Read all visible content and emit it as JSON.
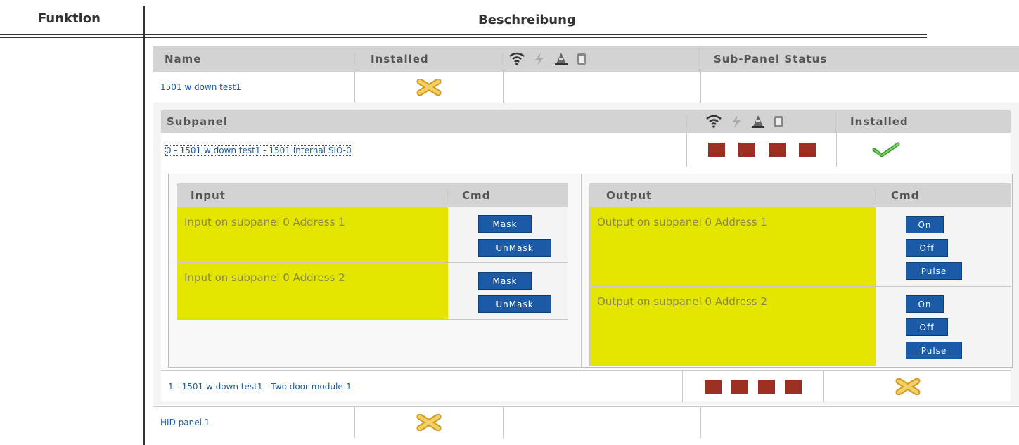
{
  "document": {
    "col_function": "Funktion",
    "col_description": "Beschreibung"
  },
  "panel_table": {
    "headers": {
      "name": "Name",
      "installed": "Installed",
      "status": "Sub-Panel Status"
    },
    "rows": [
      {
        "name": "1501 w down test1",
        "installed": "no"
      },
      {
        "name": "HID panel 1",
        "installed": "no"
      }
    ]
  },
  "subpanel_table": {
    "headers": {
      "subpanel": "Subpanel",
      "installed": "Installed"
    },
    "rows": [
      {
        "name": "0 - 1501 w down test1 - 1501 Internal SIO-0",
        "installed": "yes"
      },
      {
        "name": "1 - 1501 w down test1 - Two door module-1",
        "installed": "no"
      }
    ]
  },
  "io": {
    "input_header": "Input",
    "output_header": "Output",
    "cmd_header": "Cmd",
    "inputs": [
      {
        "label": "Input on subpanel 0 Address 1",
        "mask": "Mask",
        "unmask": "UnMask"
      },
      {
        "label": "Input on subpanel 0 Address 2",
        "mask": "Mask",
        "unmask": "UnMask"
      }
    ],
    "outputs": [
      {
        "label": "Output on subpanel 0 Address 1",
        "on": "On",
        "off": "Off",
        "pulse": "Pulse"
      },
      {
        "label": "Output on subpanel 0 Address 2",
        "on": "On",
        "off": "Off",
        "pulse": "Pulse"
      }
    ]
  },
  "status_icons": [
    "wifi-icon",
    "power-icon",
    "tamper-icon",
    "battery-icon"
  ],
  "colors": {
    "status_square": "#9b2f22",
    "highlight": "#e5e600",
    "button": "#1a5aa6",
    "link": "#1d5aa0"
  }
}
